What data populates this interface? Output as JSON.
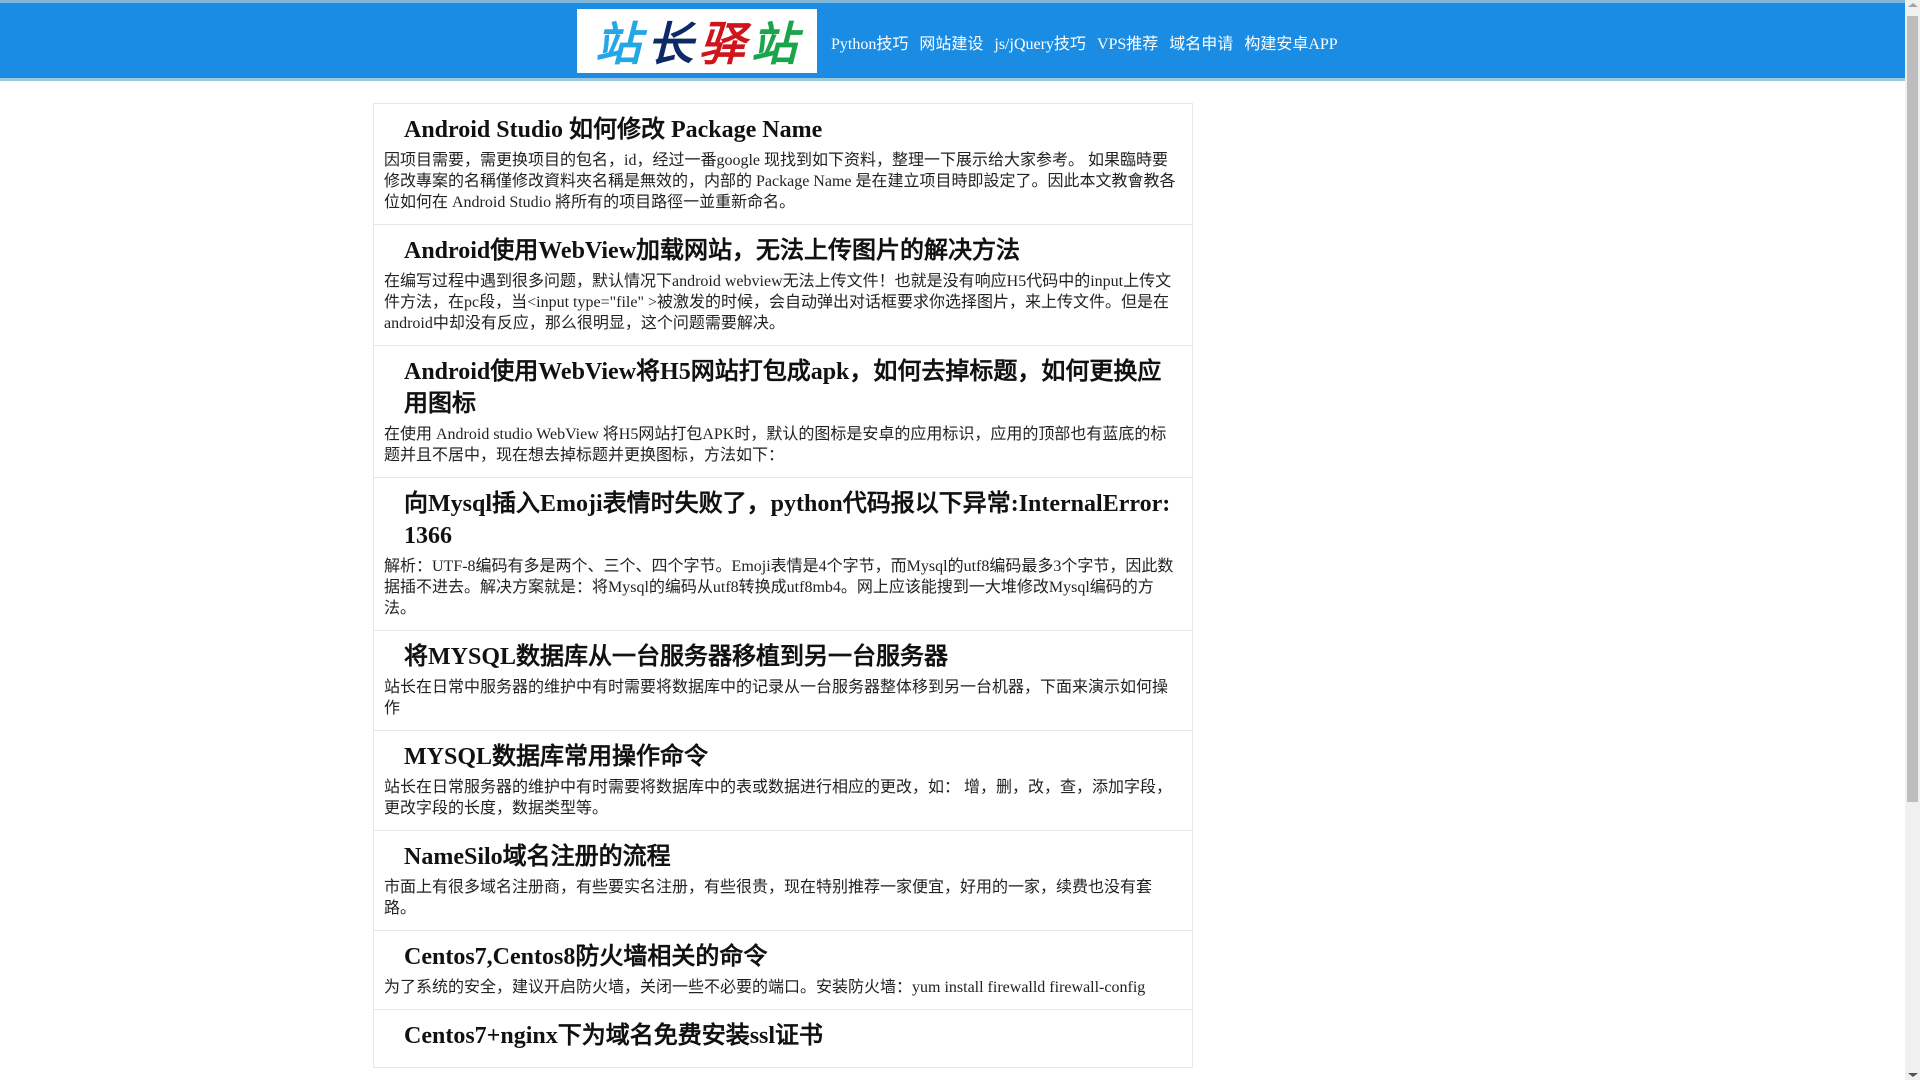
{
  "header": {
    "logo_text": [
      "站",
      "长",
      "驿",
      "站"
    ],
    "nav": [
      "Python技巧",
      "网站建设",
      "js/jQuery技巧",
      "VPS推荐",
      "域名申请",
      "构建安卓APP"
    ]
  },
  "articles": [
    {
      "title": "Android Studio 如何修改 Package Name",
      "summary": "因项目需要，需更换项目的包名，id，经过一番google 现找到如下资料，整理一下展示给大家参考。 如果臨時要修改專案的名稱僅修改資料夾名稱是無效的，内部的 Package Name 是在建立项目時即設定了。因此本文教會教各位如何在 Android Studio 將所有的项目路徑一並重新命名。"
    },
    {
      "title": "Android使用WebView加载网站，无法上传图片的解决方法",
      "summary": "在编写过程中遇到很多问题，默认情况下android webview无法上传文件！也就是没有响应H5代码中的input上传文件方法，在pc段，当<input type=\"file\" >被激发的时候，会自动弹出对话框要求你选择图片，来上传文件。但是在android中却没有反应，那么很明显，这个问题需要解决。"
    },
    {
      "title": "Android使用WebView将H5网站打包成apk，如何去掉标题，如何更换应用图标",
      "summary": "在使用 Android studio WebView 将H5网站打包APK时，默认的图标是安卓的应用标识，应用的顶部也有蓝底的标题并且不居中，现在想去掉标题并更换图标，方法如下："
    },
    {
      "title": "向Mysql插入Emoji表情时失败了，python代码报以下异常:InternalError: 1366",
      "summary": "解析：UTF-8编码有多是两个、三个、四个字节。Emoji表情是4个字节，而Mysql的utf8编码最多3个字节，因此数据插不进去。解决方案就是：将Mysql的编码从utf8转换成utf8mb4。网上应该能搜到一大堆修改Mysql编码的方法。"
    },
    {
      "title": "将MYSQL数据库从一台服务器移植到另一台服务器",
      "summary": "站长在日常中服务器的维护中有时需要将数据库中的记录从一台服务器整体移到另一台机器，下面来演示如何操作"
    },
    {
      "title": "MYSQL数据库常用操作命令",
      "summary": "站长在日常服务器的维护中有时需要将数据库中的表或数据进行相应的更改，如： 增，删，改，查，添加字段，更改字段的长度，数据类型等。"
    },
    {
      "title": "NameSilo域名注册的流程",
      "summary": "市面上有很多域名注册商，有些要实名注册，有些很贵，现在特别推荐一家便宜，好用的一家，续费也没有套路。"
    },
    {
      "title": "Centos7,Centos8防火墙相关的命令",
      "summary": "为了系统的安全，建议开启防火墙，关闭一些不必要的端口。安装防火墙：yum install firewalld firewall-config"
    },
    {
      "title": "Centos7+nginx下为域名免费安装ssl证书",
      "summary": ""
    }
  ]
}
